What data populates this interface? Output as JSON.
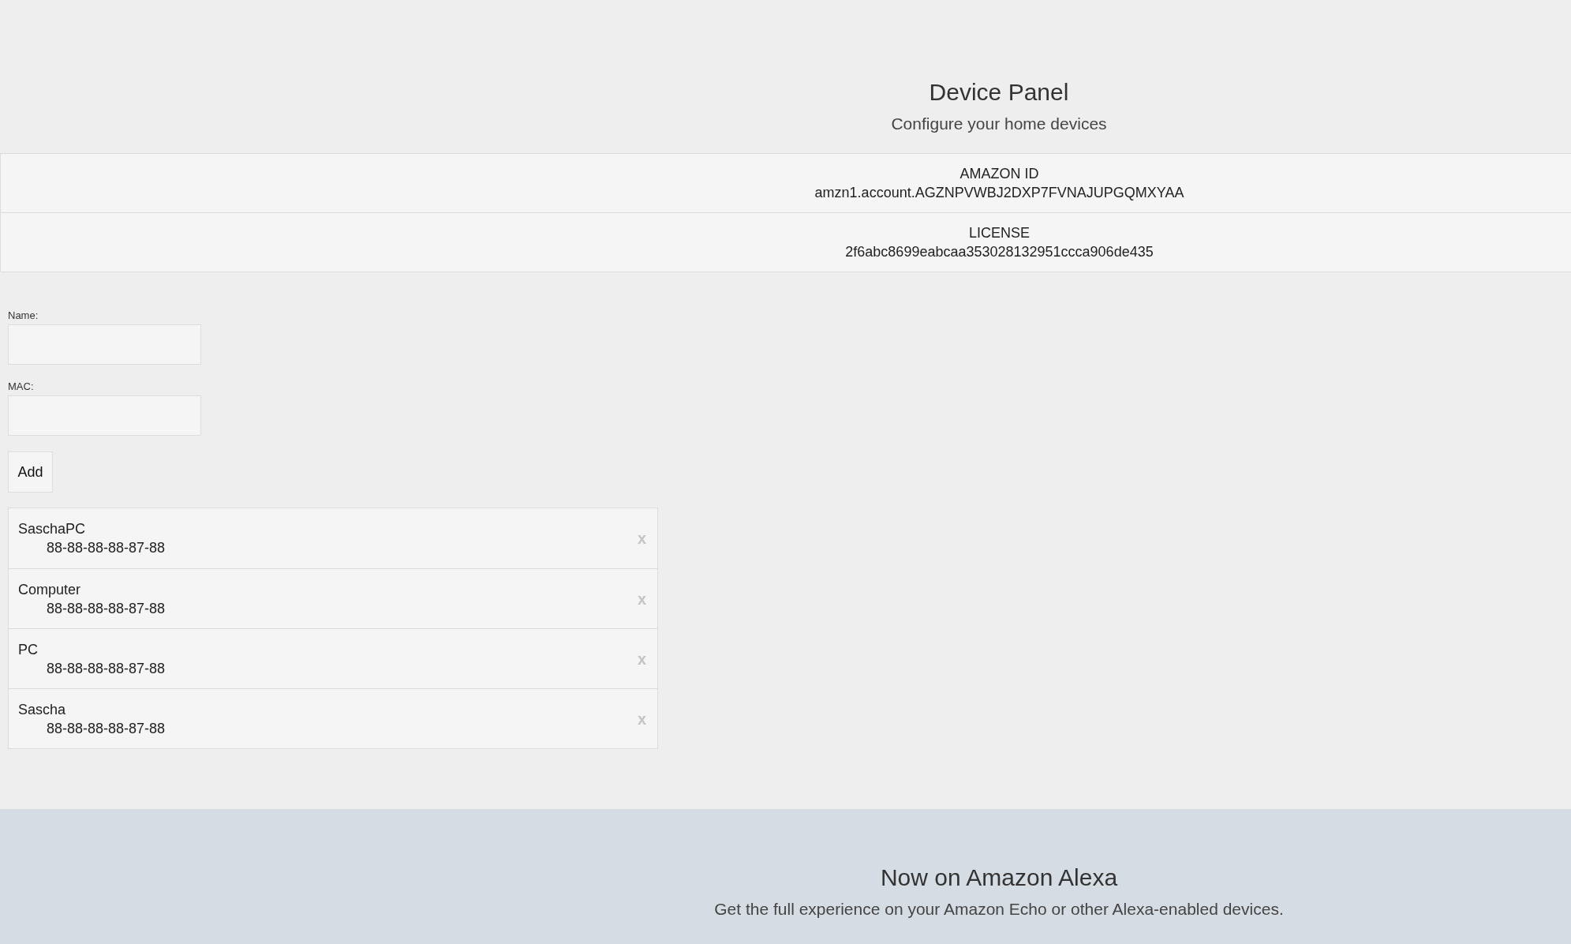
{
  "header": {
    "title": "Device Panel",
    "subtitle": "Configure your home devices"
  },
  "info": [
    {
      "label": "AMAZON ID",
      "value": "amzn1.account.AGZNPVWBJ2DXP7FVNAJUPGQMXYAA"
    },
    {
      "label": "LICENSE",
      "value": "2f6abc8699eabcaa353028132951ccca906de435"
    }
  ],
  "form": {
    "fields": [
      {
        "label": "Name:"
      },
      {
        "label": "MAC:"
      }
    ],
    "button": "Add"
  },
  "devices": [
    {
      "name": "SaschaPC",
      "mac": "88-88-88-88-87-88",
      "remove": "x"
    },
    {
      "name": "Computer",
      "mac": "88-88-88-88-87-88",
      "remove": "x"
    },
    {
      "name": "PC",
      "mac": "88-88-88-88-87-88",
      "remove": "x"
    },
    {
      "name": "Sascha",
      "mac": "88-88-88-88-87-88",
      "remove": "x"
    }
  ],
  "footer": {
    "title": "Now on Amazon Alexa",
    "subtitle": "Get the full experience on your Amazon Echo or other Alexa-enabled devices."
  }
}
